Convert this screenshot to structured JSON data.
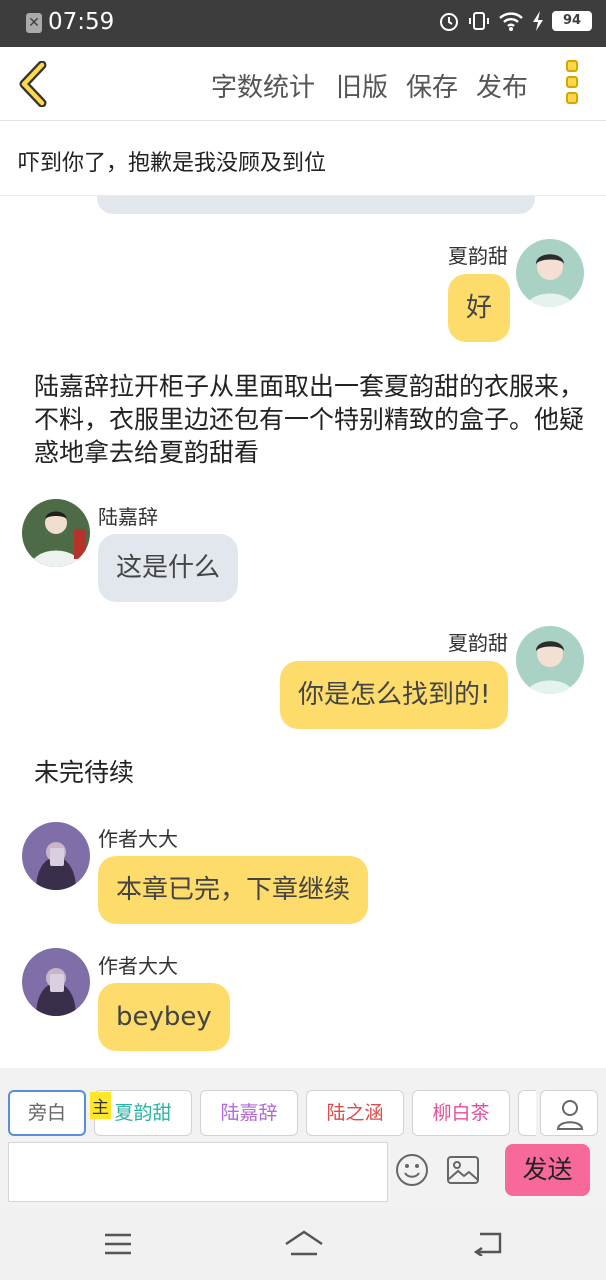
{
  "status_bar": {
    "time": "07:59",
    "battery": "94"
  },
  "top_nav": {
    "actions": [
      "字数统计",
      "旧版",
      "保存",
      "发布"
    ]
  },
  "chapter_title": "吓到你了，抱歉是我没顾及到位",
  "messages": [
    {
      "speaker": "夏韵甜",
      "text": "好"
    },
    {
      "narration": "陆嘉辞拉开柜子从里面取出一套夏韵甜的衣服来，不料，衣服里边还包有一个特别精致的盒子。他疑惑地拿去给夏韵甜看"
    },
    {
      "speaker": "陆嘉辞",
      "text": "这是什么"
    },
    {
      "speaker": "夏韵甜",
      "text": "你是怎么找到的!"
    },
    {
      "narration": "未完待续"
    },
    {
      "speaker": "作者大大",
      "text": "本章已完，下章继续"
    },
    {
      "speaker": "作者大大",
      "text": "beybey"
    }
  ],
  "compose": {
    "roles": [
      {
        "label": "旁白",
        "color": "#666666"
      },
      {
        "label": "夏韵甜",
        "color": "#2bb3a4"
      },
      {
        "label": "陆嘉辞",
        "color": "#b56ad8"
      },
      {
        "label": "陆之涵",
        "color": "#e04a4a"
      },
      {
        "label": "柳白茶",
        "color": "#e84d9a"
      }
    ],
    "main_tag": "主",
    "send_label": "发送"
  }
}
